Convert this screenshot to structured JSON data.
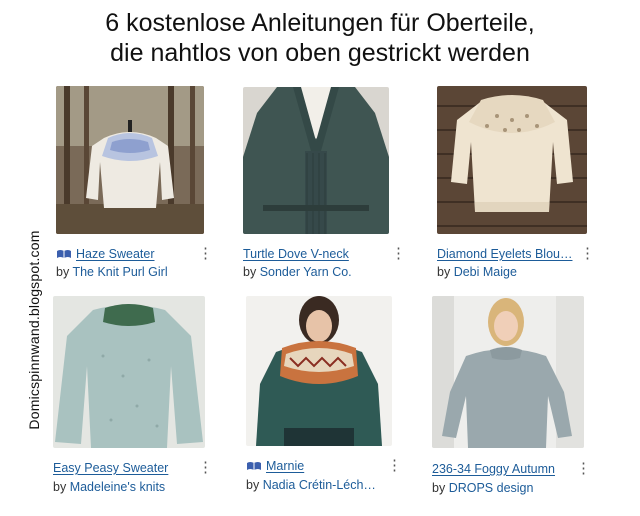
{
  "title": {
    "line1": "6 kostenlose Anleitungen für Oberteile,",
    "line2": "die nahtlos von oben gestrickt werden"
  },
  "watermark": "Domicspinnwand.blogspot.com",
  "by_word": "by",
  "more_glyph": "⋮",
  "patterns": [
    {
      "name": "Haze Sweater",
      "author": "The Knit Purl Girl",
      "library_icon": true
    },
    {
      "name": "Turtle Dove V-neck",
      "author": "Sonder Yarn Co.",
      "library_icon": false
    },
    {
      "name": "Diamond Eyelets Blou…",
      "author": "Debi Maige",
      "library_icon": false
    },
    {
      "name": "Easy Peasy Sweater",
      "author": "Madeleine's knits",
      "library_icon": false
    },
    {
      "name": "Marnie",
      "author": "Nadia Crétin-Léch…",
      "library_icon": true
    },
    {
      "name": "236-34 Foggy Autumn",
      "author": "DROPS design",
      "library_icon": false
    }
  ],
  "colors": {
    "link": "#1d5c99",
    "library_icon": "#3b5fae"
  }
}
